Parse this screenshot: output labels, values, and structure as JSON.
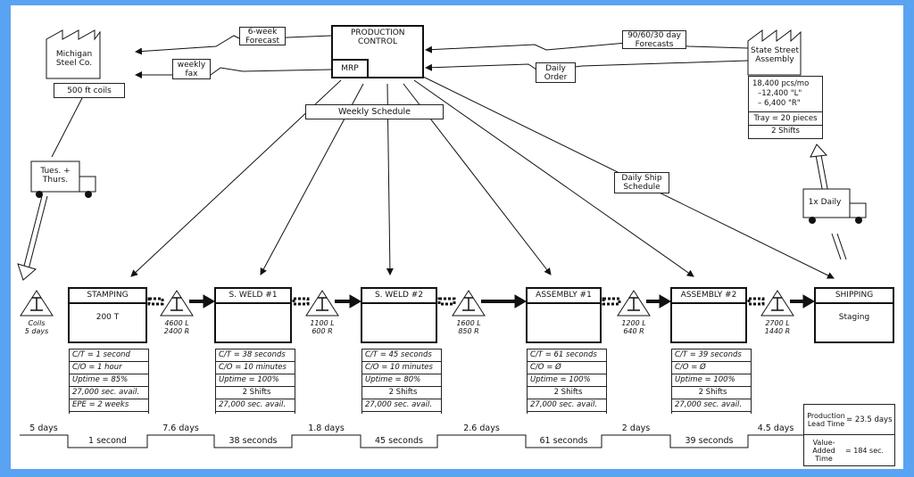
{
  "supplier": {
    "name": "Michigan Steel Co.",
    "material": "500 ft coils"
  },
  "customer": {
    "name": "State Street Assembly",
    "demand": [
      "18,400 pcs/mo",
      "–12,400 \"L\"",
      "– 6,400 \"R\""
    ],
    "tray": "Tray = 20 pieces",
    "shifts": "2 Shifts"
  },
  "control": {
    "title": "PRODUCTION CONTROL",
    "mrp": "MRP"
  },
  "flows": {
    "forecast_supplier": "6-week Forecast",
    "fax": "weekly fax",
    "forecast_customer": "90/60/30 day Forecasts",
    "daily_order": "Daily Order",
    "weekly_schedule": "Weekly Schedule",
    "daily_ship": "Daily Ship Schedule"
  },
  "shipments": {
    "inbound": "Tues. + Thurs.",
    "outbound": "1x Daily"
  },
  "processes": [
    {
      "name": "STAMPING",
      "body": "200 T",
      "data": [
        "C/T = 1 second",
        "C/O = 1 hour",
        "Uptime = 85%",
        "27,000 sec. avail.",
        "EPE = 2 weeks"
      ]
    },
    {
      "name": "S. WELD #1",
      "body": "",
      "data": [
        "C/T = 38 seconds",
        "C/O = 10 minutes",
        "Uptime = 100%",
        "2 Shifts",
        "27,000 sec. avail."
      ]
    },
    {
      "name": "S. WELD #2",
      "body": "",
      "data": [
        "C/T = 45 seconds",
        "C/O = 10 minutes",
        "Uptime = 80%",
        "2 Shifts",
        "27,000 sec. avail."
      ]
    },
    {
      "name": "ASSEMBLY #1",
      "body": "",
      "data": [
        "C/T = 61 seconds",
        "C/O = Ø",
        "Uptime = 100%",
        "2 Shifts",
        "27,000 sec. avail."
      ]
    },
    {
      "name": "ASSEMBLY #2",
      "body": "",
      "data": [
        "C/T = 39 seconds",
        "C/O = Ø",
        "Uptime = 100%",
        "2 Shifts",
        "27,000 sec. avail."
      ]
    },
    {
      "name": "SHIPPING",
      "body": "Staging"
    }
  ],
  "inventory": [
    {
      "symbol": "I",
      "l1": "Coils",
      "l2": "5 days"
    },
    {
      "symbol": "I",
      "l1": "4600 L",
      "l2": "2400 R"
    },
    {
      "symbol": "I",
      "l1": "1100 L",
      "l2": "600 R"
    },
    {
      "symbol": "I",
      "l1": "1600 L",
      "l2": "850 R"
    },
    {
      "symbol": "I",
      "l1": "1200 L",
      "l2": "640 R"
    },
    {
      "symbol": "I",
      "l1": "2700 L",
      "l2": "1440 R"
    }
  ],
  "timeline": {
    "wait": [
      "5 days",
      "7.6 days",
      "1.8 days",
      "2.6 days",
      "2 days",
      "4.5 days"
    ],
    "process": [
      "1 second",
      "38 seconds",
      "45 seconds",
      "61 seconds",
      "39 seconds"
    ]
  },
  "summary": {
    "lead_label": "Production Lead Time",
    "lead_value": "= 23.5 days",
    "va_label": "Value-Added Time",
    "va_value": "= 184 sec."
  },
  "colors": {
    "frame": "#5aa2f2"
  }
}
